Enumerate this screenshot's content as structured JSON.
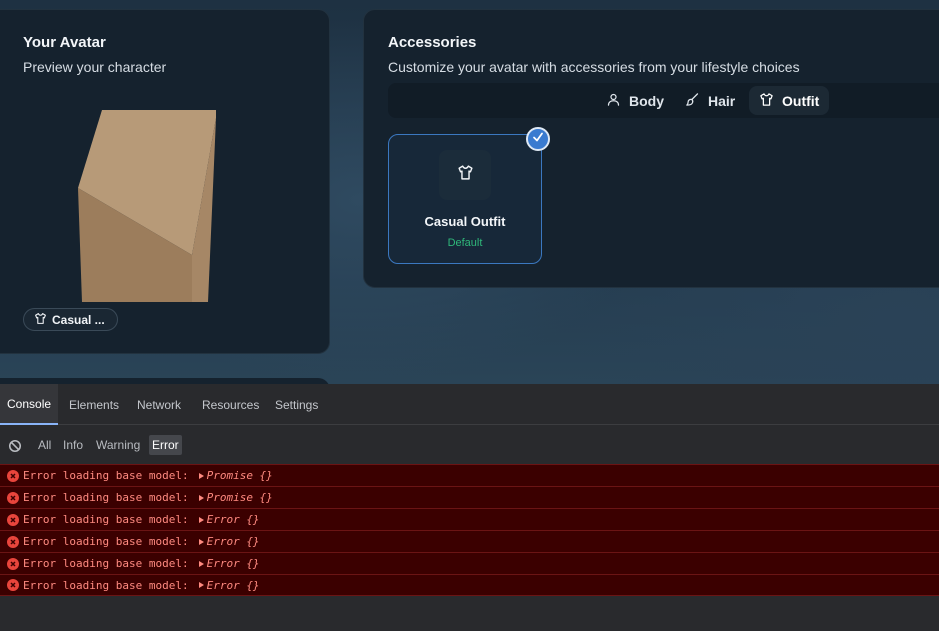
{
  "avatar_panel": {
    "title": "Your Avatar",
    "subtitle": "Preview your character",
    "outfit_chip": {
      "icon": "shirt-icon",
      "label": "Casual ..."
    }
  },
  "accessories_panel": {
    "title": "Accessories",
    "subtitle": "Customize your avatar with accessories from your lifestyle choices",
    "tabs": [
      {
        "icon": "user-icon",
        "label": "Body",
        "active": false
      },
      {
        "icon": "brush-icon",
        "label": "Hair",
        "active": false
      },
      {
        "icon": "shirt-icon",
        "label": "Outfit",
        "active": true
      }
    ],
    "items": [
      {
        "icon": "shirt-icon",
        "name": "Casual Outfit",
        "tag": "Default",
        "selected": true
      }
    ]
  },
  "devtools": {
    "tabs": [
      {
        "label": "Console",
        "active": true
      },
      {
        "label": "Elements",
        "active": false
      },
      {
        "label": "Network",
        "active": false
      },
      {
        "label": "Resources",
        "active": false
      },
      {
        "label": "Settings",
        "active": false
      }
    ],
    "filters": [
      {
        "label": "All",
        "active": false
      },
      {
        "label": "Info",
        "active": false
      },
      {
        "label": "Warning",
        "active": false
      },
      {
        "label": "Error",
        "active": true
      }
    ],
    "logs": [
      {
        "level": "error",
        "message": "Error loading base model:",
        "object": "Promise {}"
      },
      {
        "level": "error",
        "message": "Error loading base model:",
        "object": "Promise {}"
      },
      {
        "level": "error",
        "message": "Error loading base model:",
        "object": "Error {}"
      },
      {
        "level": "error",
        "message": "Error loading base model:",
        "object": "Error {}"
      },
      {
        "level": "error",
        "message": "Error loading base model:",
        "object": "Error {}"
      },
      {
        "level": "error",
        "message": "Error loading base model:",
        "object": "Error {}"
      }
    ]
  },
  "colors": {
    "accent": "#3a7bd0",
    "success": "#2fb87a",
    "error_row_bg": "#3b0000",
    "error_text": "#ff8a80"
  }
}
